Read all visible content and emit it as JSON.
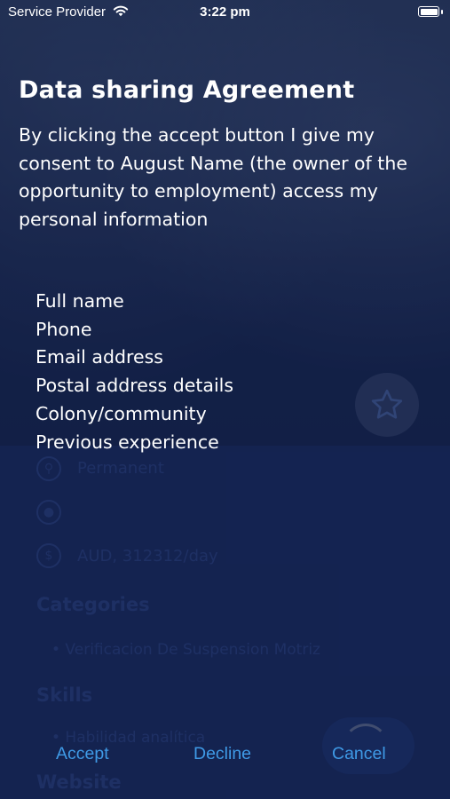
{
  "status_bar": {
    "carrier": "Service Provider",
    "time": "3:22 pm",
    "icons": [
      "wifi-icon",
      "battery-icon"
    ]
  },
  "dialog": {
    "title": "Data sharing Agreement",
    "message": "By clicking the accept button I give my consent to August Name (the owner of the opportunity to employment) access my personal information",
    "items": [
      "Full name",
      "Phone",
      "Email address",
      "Postal address details",
      "Colony/community",
      "Previous experience"
    ],
    "actions": {
      "accept": "Accept",
      "decline": "Decline",
      "cancel": "Cancel"
    },
    "action_color": "#3f9ae6"
  },
  "background_page": {
    "job_type": "Permanent",
    "salary": "AUD, 312312/day",
    "categories_heading": "Categories",
    "category_item": "• Verificacion De Suspension Motriz",
    "skills_heading": "Skills",
    "skill_item": "• Habilidad analítica",
    "website_heading": "Website",
    "icons": [
      "search-icon",
      "location-icon",
      "dollar-icon",
      "star-icon"
    ]
  }
}
